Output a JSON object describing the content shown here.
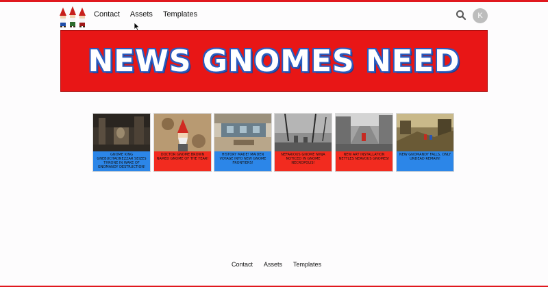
{
  "nav": {
    "items": [
      {
        "label": "Contact"
      },
      {
        "label": "Assets"
      },
      {
        "label": "Templates"
      }
    ]
  },
  "header": {
    "search_icon": "search-icon",
    "avatar_letter": "K"
  },
  "banner": {
    "title": "NEWS GNOMES NEED",
    "bg_color": "#e81616",
    "text_outline_color": "#2a5bbf"
  },
  "articles": [
    {
      "caption": "Gnome King Gnebuchadnezzar Seizes Throne in Wake of Gnomandy Destruction!",
      "caption_bg": "#2c86e8",
      "icon": "ruins-image"
    },
    {
      "caption": "Doctor Gnome Brown Named Gnome of the Year!",
      "caption_bg": "#f22b1f",
      "icon": "gnome-portrait-image"
    },
    {
      "caption": "History Made! Maiden Voyage into New Gnome Frontiers!",
      "caption_bg": "#2c86e8",
      "icon": "spaceship-interior-image"
    },
    {
      "caption": "Nefarious Gnome Ninja Noticed in Gnome Necropolis!",
      "caption_bg": "#f22b1f",
      "icon": "graveyard-image"
    },
    {
      "caption": "New Art Installation Nettles Nervous Gnomes!",
      "caption_bg": "#f22b1f",
      "icon": "city-street-image"
    },
    {
      "caption": "New Gnomandy Falls, Only Undead Remain!",
      "caption_bg": "#2c86e8",
      "icon": "wasteland-image"
    }
  ],
  "footer": {
    "items": [
      {
        "label": "Contact"
      },
      {
        "label": "Assets"
      },
      {
        "label": "Templates"
      }
    ]
  },
  "colors": {
    "accent_red": "#e0181e",
    "caption_blue": "#2c86e8",
    "caption_red": "#f22b1f"
  }
}
